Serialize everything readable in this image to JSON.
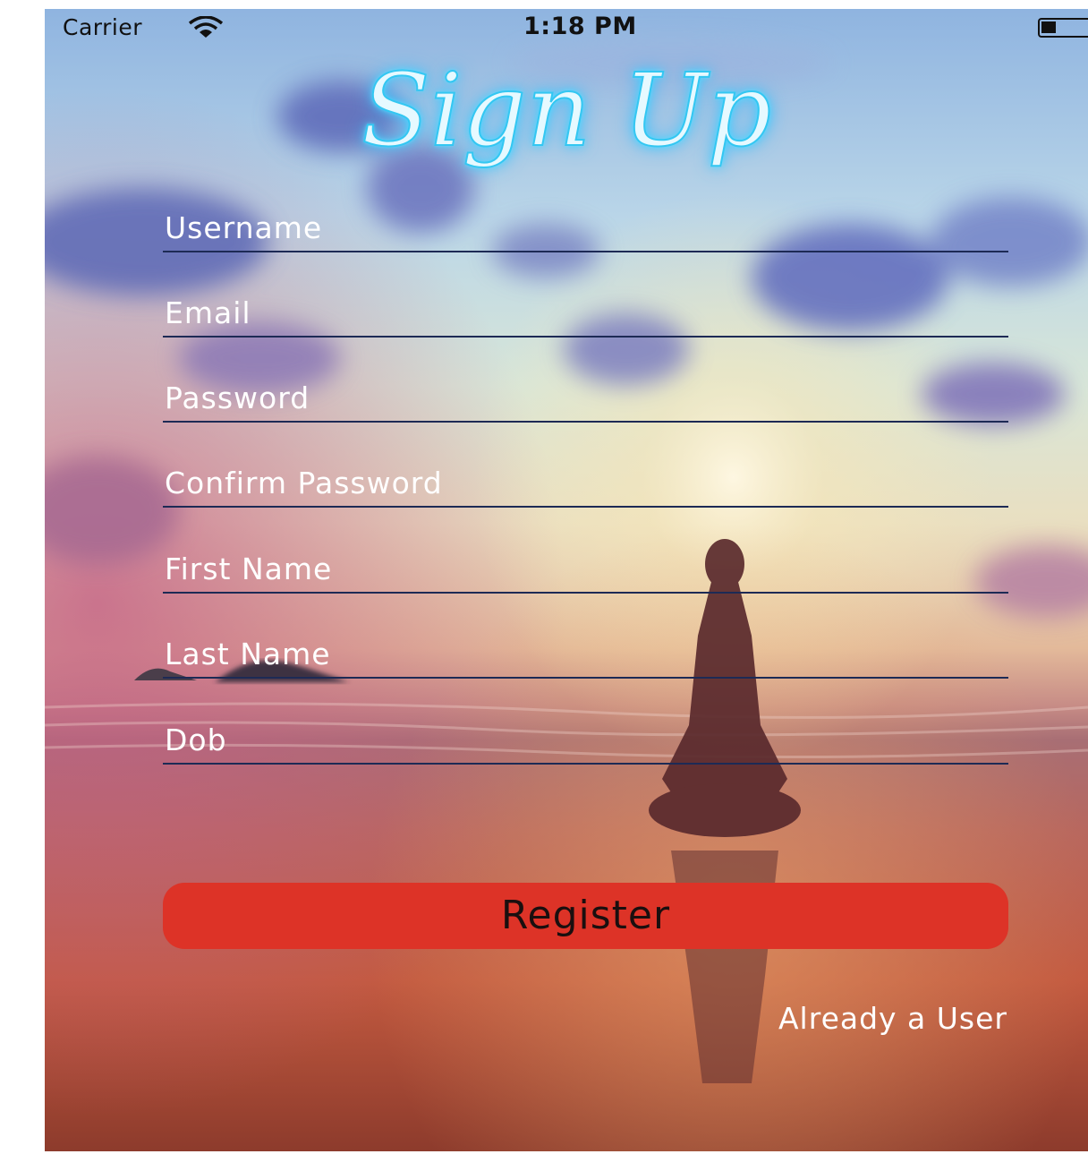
{
  "status_bar": {
    "carrier": "Carrier",
    "time": "1:18 PM",
    "wifi_icon": "wifi-icon",
    "battery_icon": "battery-icon"
  },
  "title": "Sign Up",
  "form": {
    "fields": [
      {
        "placeholder": "Username",
        "value": ""
      },
      {
        "placeholder": "Email",
        "value": ""
      },
      {
        "placeholder": "Password",
        "value": ""
      },
      {
        "placeholder": "Confirm Password",
        "value": ""
      },
      {
        "placeholder": "First Name",
        "value": ""
      },
      {
        "placeholder": "Last Name",
        "value": ""
      },
      {
        "placeholder": "Dob",
        "value": ""
      }
    ],
    "register_label": "Register",
    "already_user_label": "Already a User"
  },
  "colors": {
    "register_button": "#dd3327",
    "field_underline": "#1d2a55",
    "title_glow": "#33c7f2",
    "text": "#ffffff"
  }
}
